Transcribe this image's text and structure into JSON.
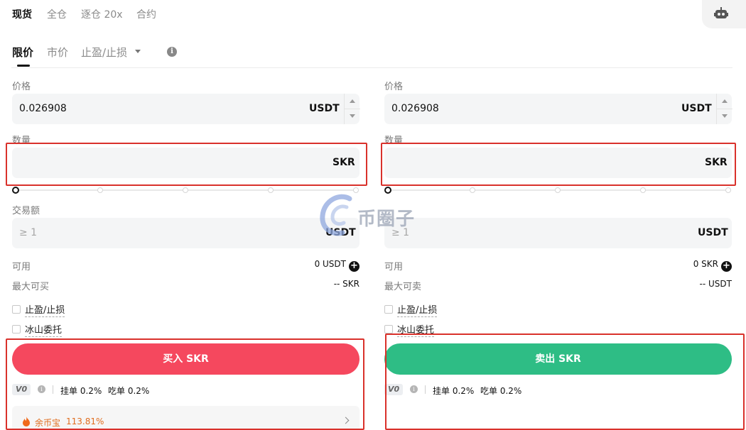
{
  "top_tabs": [
    "现货",
    "全仓",
    "逐仓 20x",
    "合约"
  ],
  "order_tabs": {
    "limit": "限价",
    "market": "市价",
    "tpsl": "止盈/止损"
  },
  "buy": {
    "price_label": "价格",
    "price_value": "0.026908",
    "price_unit": "USDT",
    "qty_label": "数量",
    "qty_unit": "SKR",
    "amount_label": "交易额",
    "amount_placeholder": "≥ 1",
    "amount_unit": "USDT",
    "available_label": "可用",
    "available_value": "0 USDT",
    "max_label": "最大可买",
    "max_value": "-- SKR",
    "tpsl_label": "止盈/止损",
    "iceberg_label": "冰山委托",
    "button_label": "买入 SKR",
    "vip_level": "V0",
    "maker_fee": "挂单 0.2%",
    "taker_fee": "吃单 0.2%",
    "earn_label": "余币宝",
    "earn_value": "113.81%"
  },
  "sell": {
    "price_label": "价格",
    "price_value": "0.026908",
    "price_unit": "USDT",
    "qty_label": "数量",
    "qty_unit": "SKR",
    "amount_placeholder": "≥ 1",
    "amount_unit": "USDT",
    "available_label": "可用",
    "available_value": "0 SKR",
    "max_label": "最大可卖",
    "max_value": "-- USDT",
    "tpsl_label": "止盈/止损",
    "iceberg_label": "冰山委托",
    "button_label": "卖出 SKR",
    "vip_level": "V0",
    "maker_fee": "挂单 0.2%",
    "taker_fee": "吃单 0.2%"
  },
  "watermark": "币圈子",
  "colors": {
    "buy": "#f5485e",
    "sell": "#2ebd85",
    "highlight": "#d9312b",
    "earn": "#e06d1f"
  },
  "icons": [
    "robot-icon",
    "info-icon",
    "add-circle-icon",
    "flame-icon",
    "chevron-right-icon"
  ]
}
